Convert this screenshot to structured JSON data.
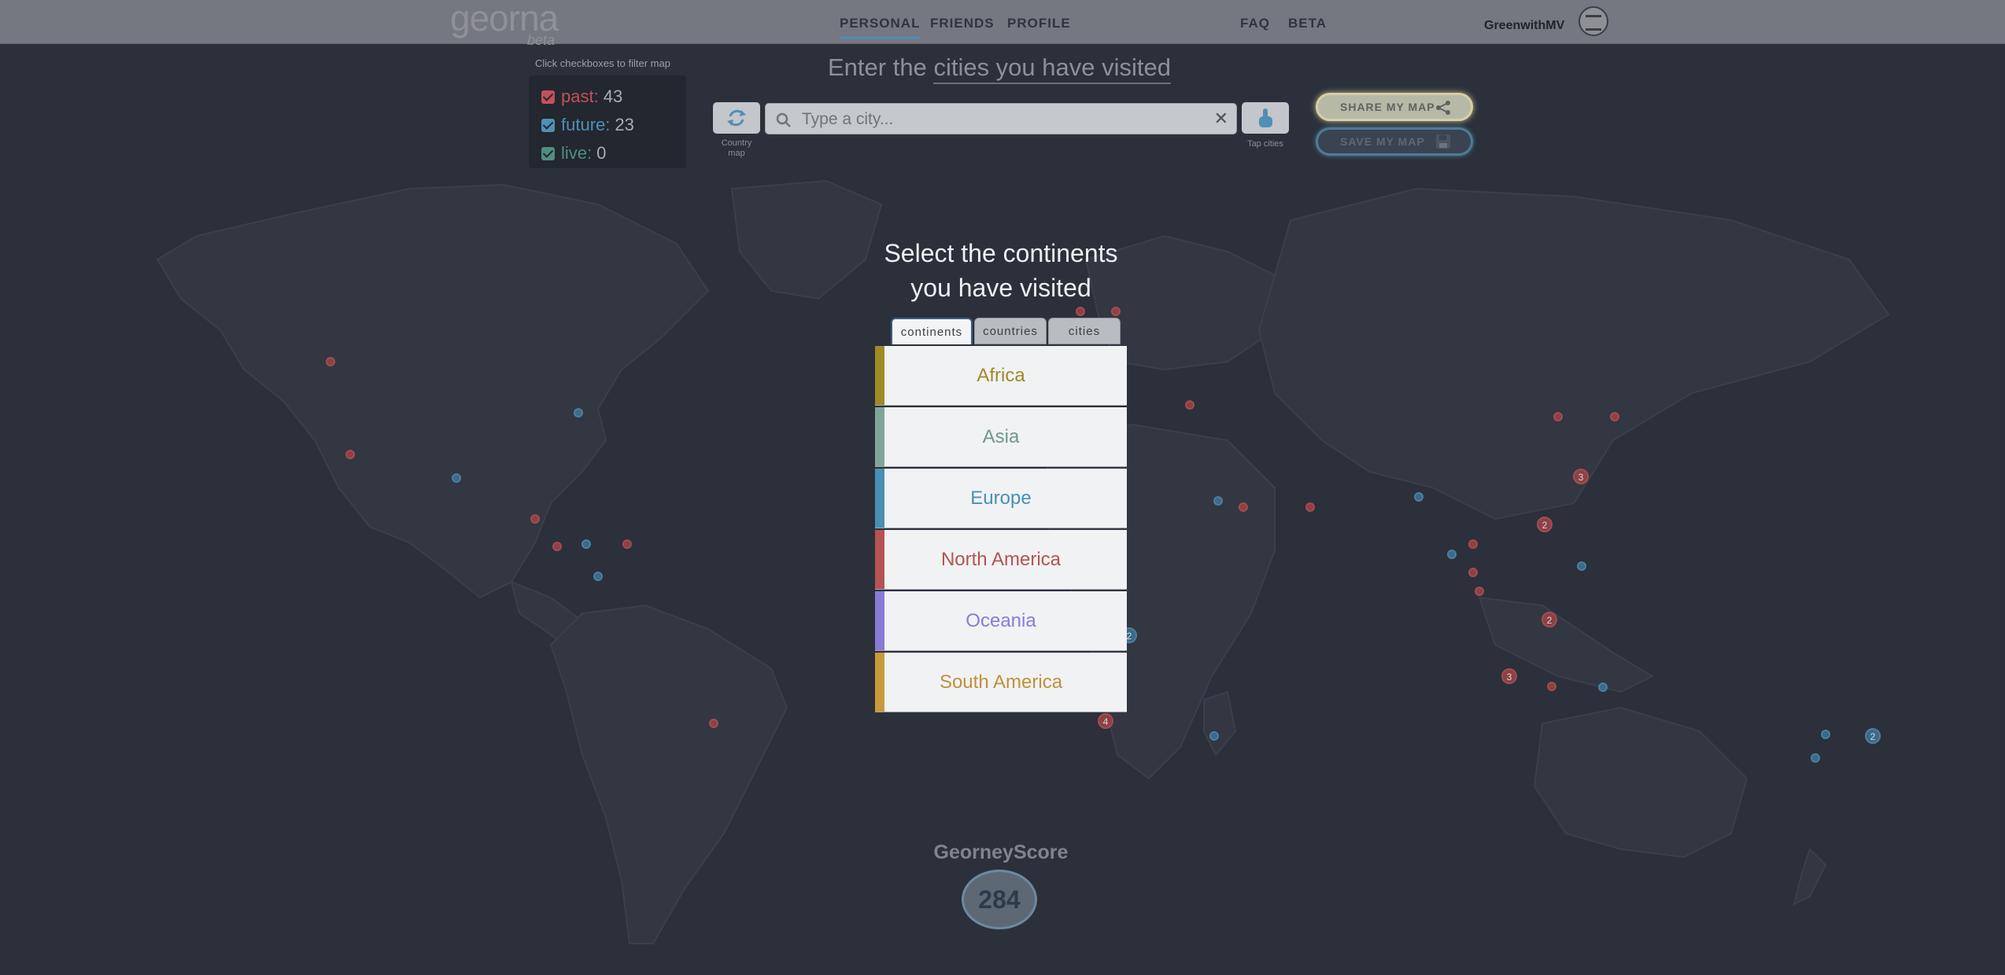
{
  "nav": {
    "logo_text": "georna",
    "logo_badge": "beta",
    "links": [
      {
        "label": "PERSONAL",
        "active": true
      },
      {
        "label": "FRIENDS",
        "active": false
      },
      {
        "label": "PROFILE",
        "active": false
      },
      {
        "label": "FAQ",
        "active": false
      },
      {
        "label": "BETA",
        "active": false
      }
    ],
    "username": "GreenwithMV"
  },
  "filter": {
    "hint": "Click checkboxes to filter map",
    "items": [
      {
        "label": "past:",
        "count": "43",
        "checked": true,
        "color": "#c5505a"
      },
      {
        "label": "future:",
        "count": "23",
        "checked": true,
        "color": "#4f8fb5"
      },
      {
        "label": "live:",
        "count": "0",
        "checked": true,
        "color": "#4f8f7f"
      }
    ]
  },
  "heading": {
    "prefix": "Enter the",
    "rotating": "cities you have visited"
  },
  "search": {
    "placeholder": "Type a city...",
    "value": "",
    "clear_icon": "close-icon"
  },
  "country_map_button": {
    "caption_line1": "Country",
    "caption_line2": "map",
    "icon": "refresh-icon"
  },
  "tap_cities_button": {
    "caption": "Tap cities",
    "icon": "pointer-icon"
  },
  "share_button": {
    "label": "SHARE MY MAP",
    "icon": "share-icon"
  },
  "save_button": {
    "label": "SAVE MY MAP",
    "icon": "floppy-disk-icon"
  },
  "panel": {
    "title_line1": "Select the continents",
    "title_line2": "you have visited",
    "tabs": [
      {
        "label": "continents",
        "active": true
      },
      {
        "label": "countries",
        "active": false
      },
      {
        "label": "cities",
        "active": false
      }
    ],
    "continents": [
      {
        "name": "Africa",
        "color": "#a08a25"
      },
      {
        "name": "Asia",
        "color": "#7fa59a"
      },
      {
        "name": "Europe",
        "color": "#4a8fb5"
      },
      {
        "name": "North America",
        "color": "#b55353"
      },
      {
        "name": "Oceania",
        "color": "#8a7ad8"
      },
      {
        "name": "South America",
        "color": "#c99a3a"
      }
    ]
  },
  "score": {
    "label": "GeorneyScore",
    "value": "284"
  },
  "map_cluster_labels": [
    "3",
    "2",
    "2",
    "3",
    "2",
    "2",
    "4"
  ],
  "colors": {
    "past": "#9a4448",
    "future": "#3f6f8f",
    "background": "#2b303b"
  }
}
